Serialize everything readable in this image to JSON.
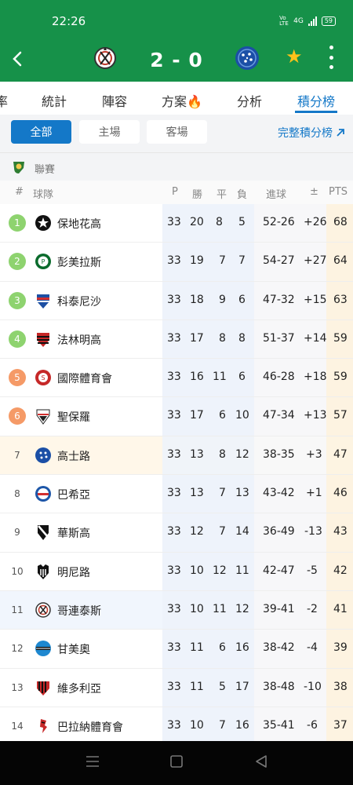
{
  "status_bar": {
    "time": "22:26",
    "network": "4G",
    "volte": "Vo LTE",
    "battery": "59"
  },
  "header": {
    "score": "2 - 0",
    "back_icon": "chevron-left-icon",
    "favorite_icon": "star-icon",
    "more_icon": "more-vertical-icon",
    "star_color": "#ffc21a"
  },
  "tabs": [
    {
      "label": "率"
    },
    {
      "label": "統計"
    },
    {
      "label": "陣容"
    },
    {
      "label": "方案🔥"
    },
    {
      "label": "分析"
    },
    {
      "label": "積分榜",
      "active": true
    }
  ],
  "filters": {
    "all": "全部",
    "home": "主場",
    "away": "客場",
    "full_table": "完整積分榜"
  },
  "league": {
    "name": "聯賽"
  },
  "columns": {
    "rank": "#",
    "team": "球隊",
    "played": "P",
    "win": "勝",
    "draw": "平",
    "loss": "負",
    "goals": "進球",
    "diff": "±",
    "pts": "PTS"
  },
  "standings": [
    {
      "rank": "1",
      "team": "保地花高",
      "p": "33",
      "w": "20",
      "d": "8",
      "l": "5",
      "goals": "52-26",
      "diff": "+26",
      "pts": "68"
    },
    {
      "rank": "2",
      "team": "彭美拉斯",
      "p": "33",
      "w": "19",
      "d": "7",
      "l": "7",
      "goals": "54-27",
      "diff": "+27",
      "pts": "64"
    },
    {
      "rank": "3",
      "team": "科泰尼沙",
      "p": "33",
      "w": "18",
      "d": "9",
      "l": "6",
      "goals": "47-32",
      "diff": "+15",
      "pts": "63"
    },
    {
      "rank": "4",
      "team": "法林明高",
      "p": "33",
      "w": "17",
      "d": "8",
      "l": "8",
      "goals": "51-37",
      "diff": "+14",
      "pts": "59"
    },
    {
      "rank": "5",
      "team": "國際體育會",
      "p": "33",
      "w": "16",
      "d": "11",
      "l": "6",
      "goals": "46-28",
      "diff": "+18",
      "pts": "59"
    },
    {
      "rank": "6",
      "team": "聖保羅",
      "p": "33",
      "w": "17",
      "d": "6",
      "l": "10",
      "goals": "47-34",
      "diff": "+13",
      "pts": "57"
    },
    {
      "rank": "7",
      "team": "高士路",
      "p": "33",
      "w": "13",
      "d": "8",
      "l": "12",
      "goals": "38-35",
      "diff": "+3",
      "pts": "47"
    },
    {
      "rank": "8",
      "team": "巴希亞",
      "p": "33",
      "w": "13",
      "d": "7",
      "l": "13",
      "goals": "43-42",
      "diff": "+1",
      "pts": "46"
    },
    {
      "rank": "9",
      "team": "華斯高",
      "p": "33",
      "w": "12",
      "d": "7",
      "l": "14",
      "goals": "36-49",
      "diff": "-13",
      "pts": "43"
    },
    {
      "rank": "10",
      "team": "明尼路",
      "p": "33",
      "w": "10",
      "d": "12",
      "l": "11",
      "goals": "42-47",
      "diff": "-5",
      "pts": "42"
    },
    {
      "rank": "11",
      "team": "哥連泰斯",
      "p": "33",
      "w": "10",
      "d": "11",
      "l": "12",
      "goals": "39-41",
      "diff": "-2",
      "pts": "41"
    },
    {
      "rank": "12",
      "team": "甘美奧",
      "p": "33",
      "w": "11",
      "d": "6",
      "l": "16",
      "goals": "38-42",
      "diff": "-4",
      "pts": "39"
    },
    {
      "rank": "13",
      "team": "維多利亞",
      "p": "33",
      "w": "11",
      "d": "5",
      "l": "17",
      "goals": "38-48",
      "diff": "-10",
      "pts": "38"
    },
    {
      "rank": "14",
      "team": "巴拉納體育會",
      "p": "33",
      "w": "10",
      "d": "7",
      "l": "16",
      "goals": "35-41",
      "diff": "-6",
      "pts": "37"
    }
  ],
  "colors": {
    "primary_green": "#169149",
    "accent_blue": "#1478c8",
    "cl_green": "#8ed36f",
    "qual_orange": "#f59a67"
  }
}
